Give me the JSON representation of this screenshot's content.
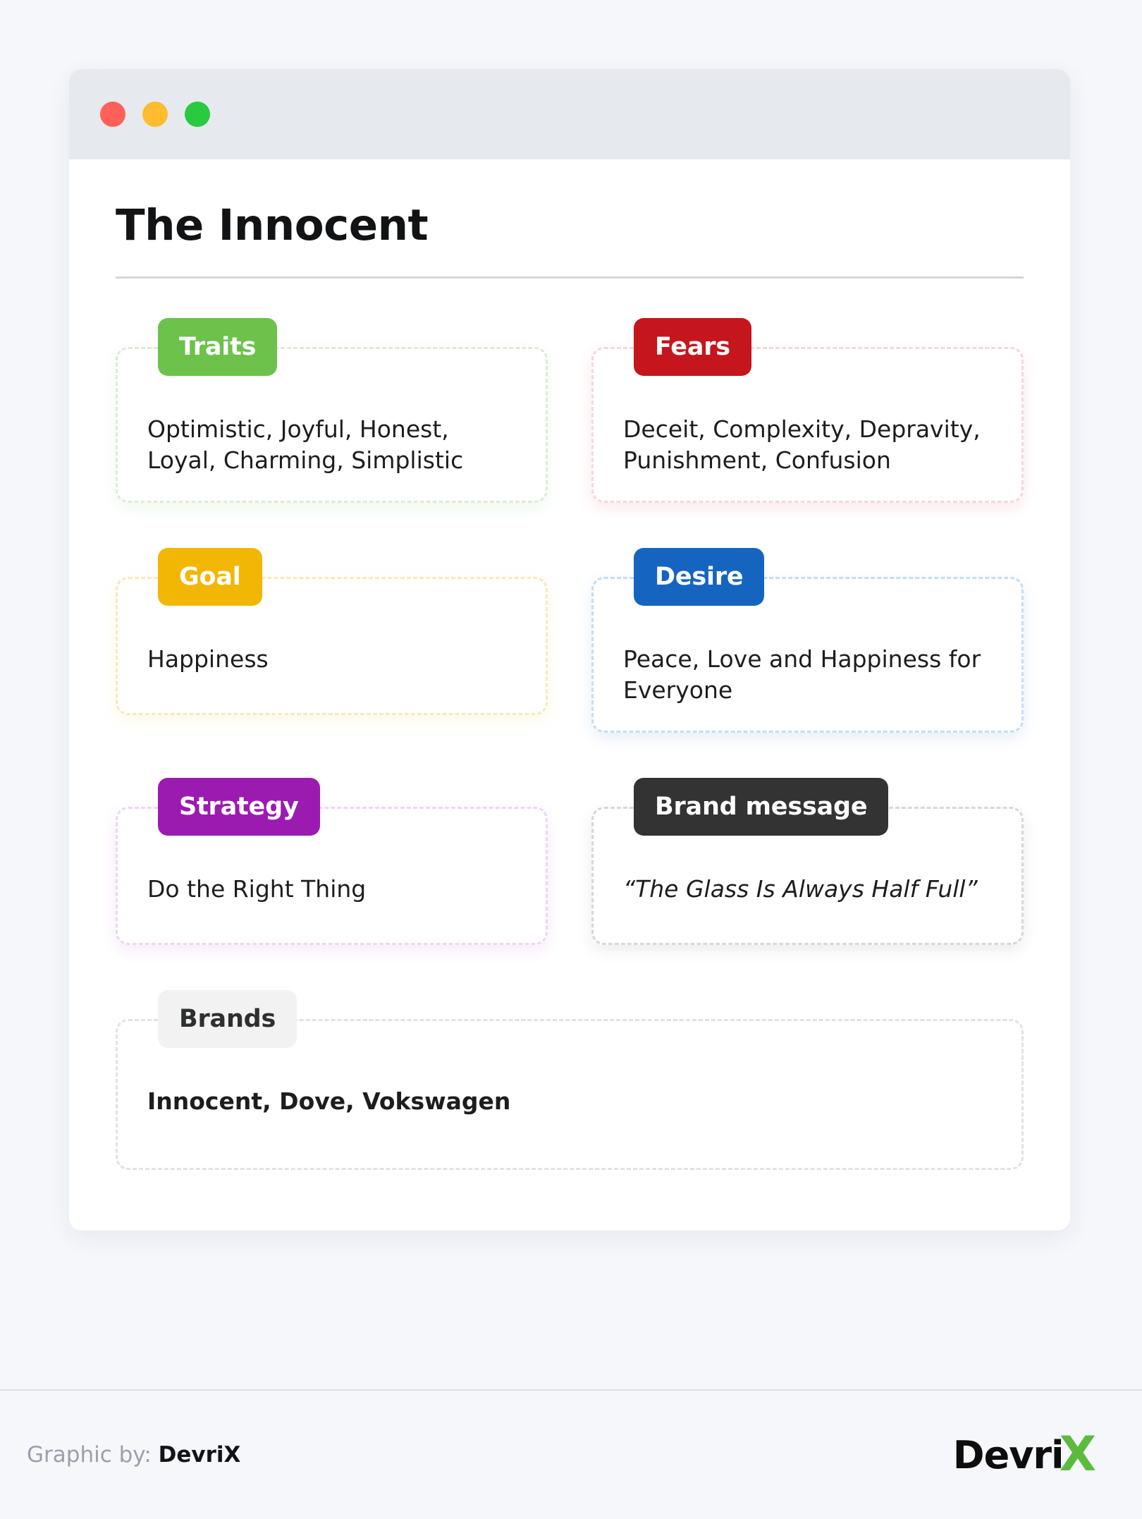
{
  "window": {
    "dots": [
      {
        "name": "close",
        "color": "#ff6159"
      },
      {
        "name": "minimize",
        "color": "#ffbc2e"
      },
      {
        "name": "zoom",
        "color": "#29c940"
      }
    ]
  },
  "archetype": {
    "title": "The Innocent"
  },
  "cards": [
    {
      "key": "traits",
      "badge": "Traits",
      "badge_color": "#6cc24a",
      "text": "Optimistic, Joyful, Honest, Loyal, Charming, Simplistic"
    },
    {
      "key": "fears",
      "badge": "Fears",
      "badge_color": "#c4161c",
      "text": "Deceit, Complexity, Depravity, Punishment, Confusion"
    },
    {
      "key": "goal",
      "badge": "Goal",
      "badge_color": "#f2b705",
      "text": "Happiness"
    },
    {
      "key": "desire",
      "badge": "Desire",
      "badge_color": "#1565c0",
      "text": "Peace, Love and Happiness for Everyone"
    },
    {
      "key": "strategy",
      "badge": "Strategy",
      "badge_color": "#9b1bb0",
      "text": "Do the Right Thing"
    },
    {
      "key": "brand_message",
      "badge": "Brand message",
      "badge_color": "#333333",
      "text": "“The Glass Is Always Half Full”"
    },
    {
      "key": "brands",
      "badge": "Brands",
      "badge_color": "#f2f2f2",
      "text": "Innocent, Dove, Vokswagen"
    }
  ],
  "footer": {
    "credit_label": "Graphic by:",
    "credit_name": "DevriX",
    "logo_text": "Devri",
    "logo_mark": "X"
  }
}
